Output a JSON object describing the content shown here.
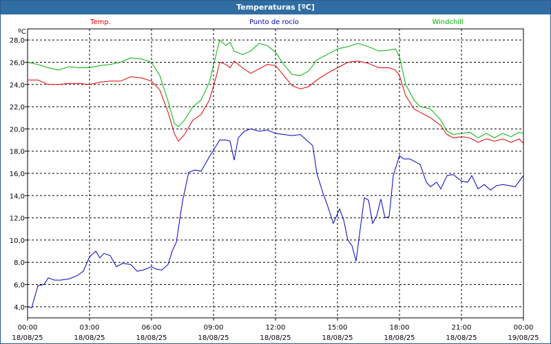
{
  "window": {
    "title": "Temperaturas [ºC]"
  },
  "chart_data": {
    "type": "line",
    "title": "Temperaturas [ºC]",
    "ylabel": "ºC",
    "ylim": [
      3,
      29
    ],
    "xlim": [
      0,
      24
    ],
    "yticks": [
      4,
      6,
      8,
      10,
      12,
      14,
      16,
      18,
      20,
      22,
      24,
      26,
      28
    ],
    "ytick_labels": [
      "4,0",
      "6,0",
      "8,0",
      "10,0",
      "12,0",
      "14,0",
      "16,0",
      "18,0",
      "20,0",
      "22,0",
      "24,0",
      "26,0",
      "28,0"
    ],
    "xticks": [
      {
        "x": 0,
        "time": "00:00",
        "date": "18/08/25"
      },
      {
        "x": 3,
        "time": "03:00",
        "date": "18/08/25"
      },
      {
        "x": 6,
        "time": "06:00",
        "date": "18/08/25"
      },
      {
        "x": 9,
        "time": "09:00",
        "date": "18/08/25"
      },
      {
        "x": 12,
        "time": "12:00",
        "date": "18/08/25"
      },
      {
        "x": 15,
        "time": "15:00",
        "date": "18/08/25"
      },
      {
        "x": 18,
        "time": "18:00",
        "date": "18/08/25"
      },
      {
        "x": 21,
        "time": "21:00",
        "date": "18/08/25"
      },
      {
        "x": 24,
        "time": "00:00",
        "date": "19/08/25"
      }
    ],
    "grid": true,
    "legend_placement": "top",
    "series": [
      {
        "name": "Temp.",
        "color": "#e00000",
        "points": [
          [
            0,
            24.4
          ],
          [
            0.5,
            24.4
          ],
          [
            1,
            24.0
          ],
          [
            1.5,
            24.0
          ],
          [
            2,
            24.1
          ],
          [
            2.5,
            24.1
          ],
          [
            3,
            24.0
          ],
          [
            3.5,
            24.2
          ],
          [
            4,
            24.3
          ],
          [
            4.5,
            24.3
          ],
          [
            5,
            24.7
          ],
          [
            5.5,
            24.6
          ],
          [
            6,
            24.3
          ],
          [
            6.4,
            23.5
          ],
          [
            6.8,
            21.5
          ],
          [
            7.1,
            19.6
          ],
          [
            7.3,
            18.9
          ],
          [
            7.6,
            19.5
          ],
          [
            8,
            20.8
          ],
          [
            8.4,
            21.3
          ],
          [
            8.8,
            22.6
          ],
          [
            9.1,
            24.5
          ],
          [
            9.3,
            26.0
          ],
          [
            9.6,
            25.8
          ],
          [
            9.8,
            25.5
          ],
          [
            10,
            26.1
          ],
          [
            10.4,
            25.5
          ],
          [
            10.8,
            25.0
          ],
          [
            11.2,
            25.4
          ],
          [
            11.6,
            25.8
          ],
          [
            12,
            25.7
          ],
          [
            12.4,
            24.8
          ],
          [
            12.8,
            23.9
          ],
          [
            13.2,
            23.6
          ],
          [
            13.6,
            23.8
          ],
          [
            14,
            24.4
          ],
          [
            14.5,
            25.0
          ],
          [
            15,
            25.5
          ],
          [
            15.5,
            26.0
          ],
          [
            16,
            26.1
          ],
          [
            16.5,
            25.9
          ],
          [
            17,
            25.5
          ],
          [
            17.5,
            25.5
          ],
          [
            17.8,
            25.3
          ],
          [
            18,
            24.8
          ],
          [
            18.3,
            23.0
          ],
          [
            18.7,
            21.8
          ],
          [
            19,
            21.5
          ],
          [
            19.5,
            21.0
          ],
          [
            20,
            20.3
          ],
          [
            20.3,
            19.5
          ],
          [
            20.6,
            19.2
          ],
          [
            21,
            19.3
          ],
          [
            21.4,
            19.2
          ],
          [
            21.8,
            18.8
          ],
          [
            22.2,
            19.1
          ],
          [
            22.6,
            18.9
          ],
          [
            23,
            19.1
          ],
          [
            23.4,
            18.8
          ],
          [
            23.8,
            19.1
          ],
          [
            24,
            18.7
          ]
        ]
      },
      {
        "name": "Punto de rocío",
        "color": "#0000c0",
        "points": [
          [
            0,
            4.0
          ],
          [
            0.2,
            3.9
          ],
          [
            0.5,
            5.9
          ],
          [
            0.8,
            6.0
          ],
          [
            1,
            6.6
          ],
          [
            1.3,
            6.4
          ],
          [
            1.6,
            6.4
          ],
          [
            2,
            6.5
          ],
          [
            2.4,
            6.8
          ],
          [
            2.7,
            7.2
          ],
          [
            3,
            8.5
          ],
          [
            3.3,
            9.0
          ],
          [
            3.5,
            8.4
          ],
          [
            3.7,
            8.8
          ],
          [
            4,
            8.6
          ],
          [
            4.3,
            7.6
          ],
          [
            4.6,
            7.9
          ],
          [
            5,
            7.8
          ],
          [
            5.3,
            7.2
          ],
          [
            5.6,
            7.3
          ],
          [
            6,
            7.6
          ],
          [
            6.2,
            7.4
          ],
          [
            6.5,
            7.3
          ],
          [
            6.8,
            7.8
          ],
          [
            7,
            9.0
          ],
          [
            7.2,
            9.8
          ],
          [
            7.5,
            13.5
          ],
          [
            7.8,
            16.1
          ],
          [
            8.1,
            16.3
          ],
          [
            8.4,
            16.2
          ],
          [
            8.8,
            17.5
          ],
          [
            9.1,
            18.4
          ],
          [
            9.3,
            19.0
          ],
          [
            9.6,
            19.0
          ],
          [
            9.8,
            18.9
          ],
          [
            10,
            17.2
          ],
          [
            10.2,
            19.2
          ],
          [
            10.5,
            19.8
          ],
          [
            10.8,
            20.0
          ],
          [
            11.2,
            19.8
          ],
          [
            11.6,
            19.9
          ],
          [
            12,
            19.6
          ],
          [
            12.4,
            19.5
          ],
          [
            12.8,
            19.4
          ],
          [
            13.2,
            19.5
          ],
          [
            13.5,
            19.0
          ],
          [
            13.8,
            18.5
          ],
          [
            14.0,
            16.0
          ],
          [
            14.3,
            14.2
          ],
          [
            14.5,
            13.2
          ],
          [
            14.8,
            11.5
          ],
          [
            15.1,
            12.8
          ],
          [
            15.3,
            11.8
          ],
          [
            15.5,
            10.0
          ],
          [
            15.7,
            9.5
          ],
          [
            15.9,
            8.1
          ],
          [
            16.1,
            11.0
          ],
          [
            16.3,
            13.8
          ],
          [
            16.5,
            13.6
          ],
          [
            16.7,
            11.5
          ],
          [
            16.9,
            12.2
          ],
          [
            17.1,
            13.7
          ],
          [
            17.3,
            12.0
          ],
          [
            17.5,
            12.1
          ],
          [
            17.7,
            15.8
          ],
          [
            18.0,
            17.6
          ],
          [
            18.2,
            17.3
          ],
          [
            18.5,
            17.3
          ],
          [
            18.8,
            17.0
          ],
          [
            19.0,
            16.8
          ],
          [
            19.3,
            15.2
          ],
          [
            19.5,
            14.8
          ],
          [
            19.8,
            15.2
          ],
          [
            20.0,
            14.6
          ],
          [
            20.3,
            15.8
          ],
          [
            20.6,
            15.9
          ],
          [
            21.0,
            15.3
          ],
          [
            21.3,
            15.2
          ],
          [
            21.5,
            15.8
          ],
          [
            21.8,
            14.6
          ],
          [
            22.1,
            15.0
          ],
          [
            22.4,
            14.5
          ],
          [
            22.7,
            14.9
          ],
          [
            23.0,
            15.0
          ],
          [
            23.3,
            14.9
          ],
          [
            23.6,
            14.8
          ],
          [
            24,
            15.8
          ]
        ]
      },
      {
        "name": "Windchill",
        "color": "#00b000",
        "points": [
          [
            0,
            26.0
          ],
          [
            0.5,
            25.8
          ],
          [
            1,
            25.5
          ],
          [
            1.5,
            25.3
          ],
          [
            2,
            25.6
          ],
          [
            2.5,
            25.5
          ],
          [
            3,
            25.5
          ],
          [
            3.5,
            25.7
          ],
          [
            4,
            25.8
          ],
          [
            4.5,
            26.0
          ],
          [
            5,
            26.4
          ],
          [
            5.5,
            26.3
          ],
          [
            6,
            26.0
          ],
          [
            6.4,
            24.8
          ],
          [
            6.8,
            22.5
          ],
          [
            7.1,
            20.5
          ],
          [
            7.3,
            20.2
          ],
          [
            7.6,
            20.8
          ],
          [
            8,
            22.0
          ],
          [
            8.4,
            22.6
          ],
          [
            8.8,
            24.2
          ],
          [
            9.1,
            26.5
          ],
          [
            9.3,
            28.0
          ],
          [
            9.6,
            27.5
          ],
          [
            9.8,
            27.8
          ],
          [
            10,
            27.0
          ],
          [
            10.4,
            26.7
          ],
          [
            10.8,
            27.0
          ],
          [
            11.2,
            27.7
          ],
          [
            11.6,
            27.5
          ],
          [
            12,
            26.9
          ],
          [
            12.4,
            25.8
          ],
          [
            12.8,
            24.9
          ],
          [
            13.2,
            24.8
          ],
          [
            13.6,
            25.2
          ],
          [
            14,
            26.2
          ],
          [
            14.5,
            26.7
          ],
          [
            15,
            27.2
          ],
          [
            15.5,
            27.4
          ],
          [
            16,
            27.7
          ],
          [
            16.5,
            27.4
          ],
          [
            17,
            27.0
          ],
          [
            17.5,
            27.1
          ],
          [
            17.8,
            27.2
          ],
          [
            18,
            26.5
          ],
          [
            18.3,
            24.0
          ],
          [
            18.7,
            22.6
          ],
          [
            19,
            22.0
          ],
          [
            19.5,
            21.8
          ],
          [
            20,
            20.8
          ],
          [
            20.3,
            19.8
          ],
          [
            20.6,
            19.5
          ],
          [
            21,
            19.6
          ],
          [
            21.4,
            19.7
          ],
          [
            21.8,
            19.2
          ],
          [
            22.2,
            19.6
          ],
          [
            22.6,
            19.2
          ],
          [
            23,
            19.6
          ],
          [
            23.4,
            19.3
          ],
          [
            23.8,
            19.7
          ],
          [
            24,
            19.6
          ]
        ]
      }
    ]
  }
}
